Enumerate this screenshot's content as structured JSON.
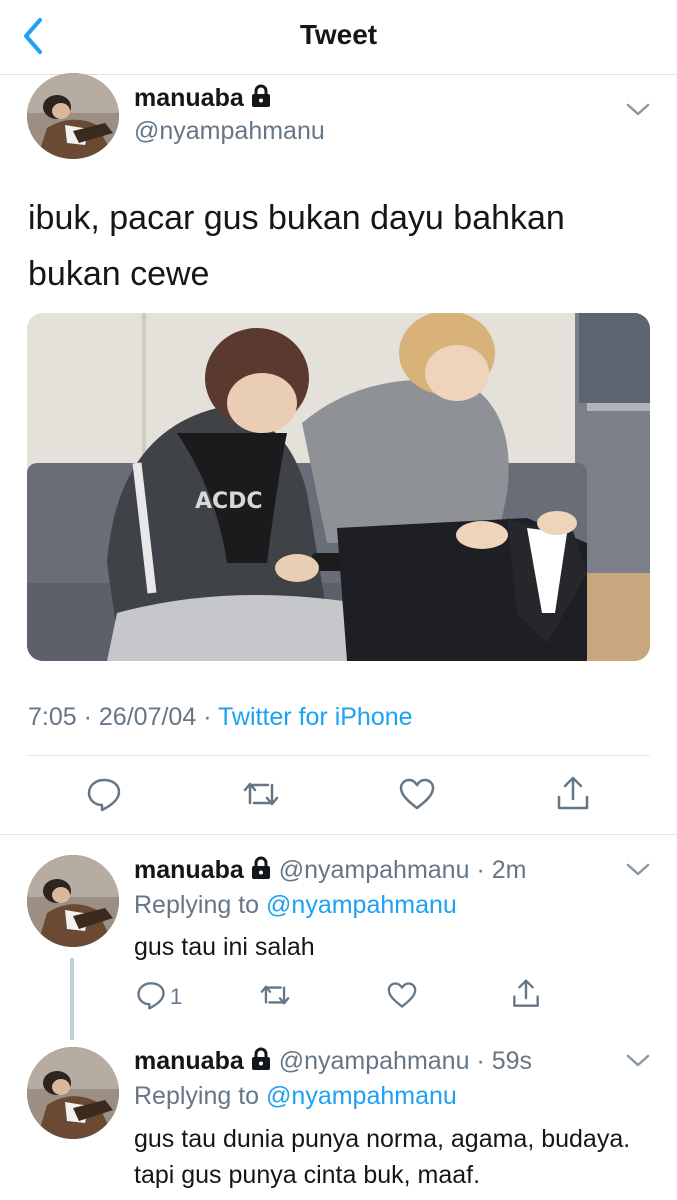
{
  "header": {
    "title": "Tweet",
    "back_icon": "chevron-left-icon"
  },
  "tweet": {
    "display_name": "manuaba",
    "handle": "@nyampahmanu",
    "text": "ibuk, pacar gus bukan dayu bahkan bukan cewe",
    "time": "7:05",
    "date": "26/07/04",
    "separator": "·",
    "source": "Twitter for iPhone"
  },
  "replies": [
    {
      "display_name": "manuaba",
      "handle": "@nyampahmanu",
      "time_ago": "· 2m",
      "replying_prefix": "Replying to",
      "replying_to": "@nyampahmanu",
      "text": "gus tau ini salah",
      "reply_count": "1"
    },
    {
      "display_name": "manuaba",
      "handle": "@nyampahmanu",
      "time_ago": "· 59s",
      "replying_prefix": "Replying to",
      "replying_to": "@nyampahmanu",
      "text": "gus tau dunia punya norma, agama, budaya. tapi gus punya cinta buk, maaf."
    }
  ],
  "colors": {
    "accent": "#1da1f2",
    "muted": "#657786",
    "text": "#14171a",
    "divider": "#e1e8ed"
  }
}
